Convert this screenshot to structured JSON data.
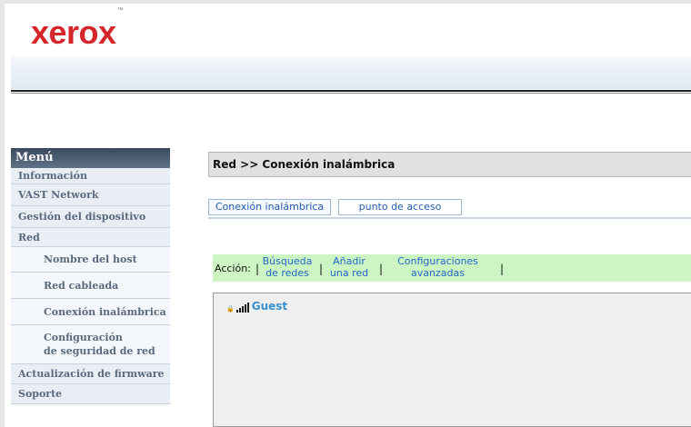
{
  "brand": {
    "logo": "xerox",
    "tm": "™",
    "color": "#d5262b"
  },
  "sidebar": {
    "header": "Menú",
    "items": [
      {
        "label": "Información",
        "sub": false
      },
      {
        "label": "VAST Network",
        "sub": false
      },
      {
        "label": "Gestión del dispositivo",
        "sub": false
      },
      {
        "label": "Red",
        "sub": false
      },
      {
        "label": "Nombre del host",
        "sub": true
      },
      {
        "label": "Red cableada",
        "sub": true
      },
      {
        "label": "Conexión inalámbrica",
        "sub": true
      },
      {
        "label": "Configuración de seguridad de red",
        "line1": "Configuración",
        "line2": "de seguridad de red",
        "sub": true
      },
      {
        "label": "Actualización de firmware",
        "sub": false
      },
      {
        "label": "Soporte",
        "sub": false
      }
    ]
  },
  "main": {
    "title": "Red >> Conexión inalámbrica",
    "tabs": [
      {
        "label": "Conexión inalámbrica",
        "active": true
      },
      {
        "label": "punto de acceso",
        "active": false
      }
    ],
    "actions": {
      "label": "Acción:",
      "sep": "|",
      "search_line1": "Búsqueda",
      "search_line2": "de redes",
      "add_line1": "Añadir",
      "add_line2": "una red",
      "advanced_line1": "Configuraciones",
      "advanced_line2": "avanzadas"
    },
    "networks": [
      {
        "name": "Guest",
        "signal_bars": 4,
        "secured": true,
        "icon": "lock-icon"
      }
    ]
  }
}
